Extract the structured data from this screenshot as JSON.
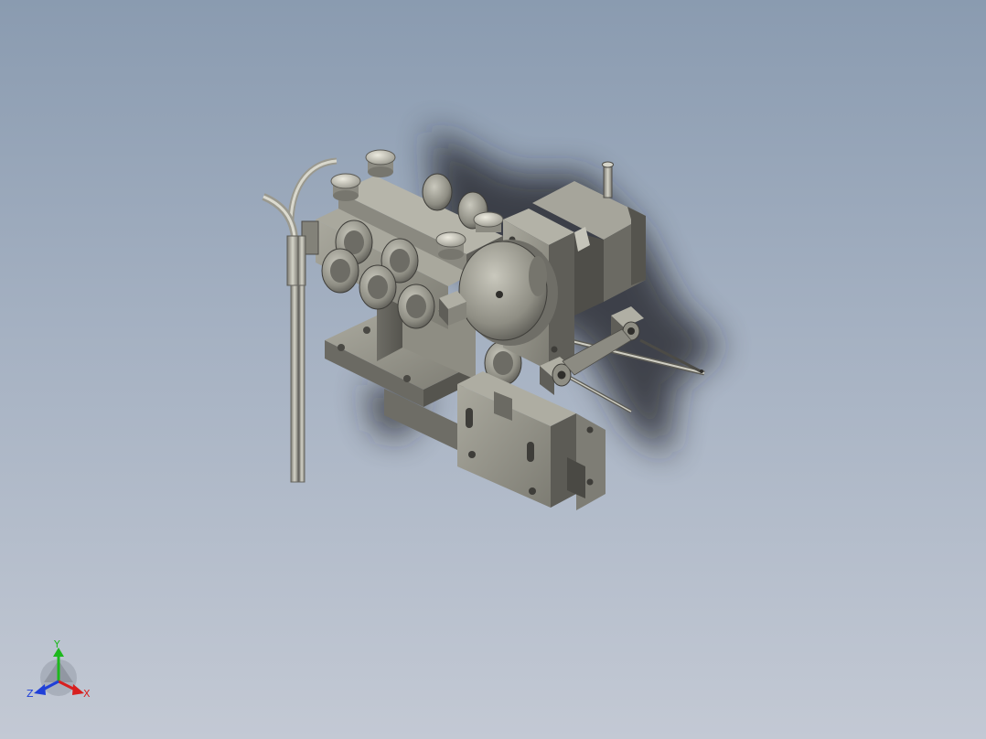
{
  "viewport": {
    "background_top": "#8a9bb0",
    "background_bottom": "#c3c9d4"
  },
  "model": {
    "part_color": "#8f8e84",
    "part_dark": "#5c5b55",
    "part_light": "#b9b8ad",
    "shadow_color": "#1a1c22"
  },
  "triad": {
    "x_label": "X",
    "y_label": "Y",
    "z_label": "Z",
    "x_color": "#d81f1f",
    "y_color": "#1db81d",
    "z_color": "#1f3fd8"
  }
}
